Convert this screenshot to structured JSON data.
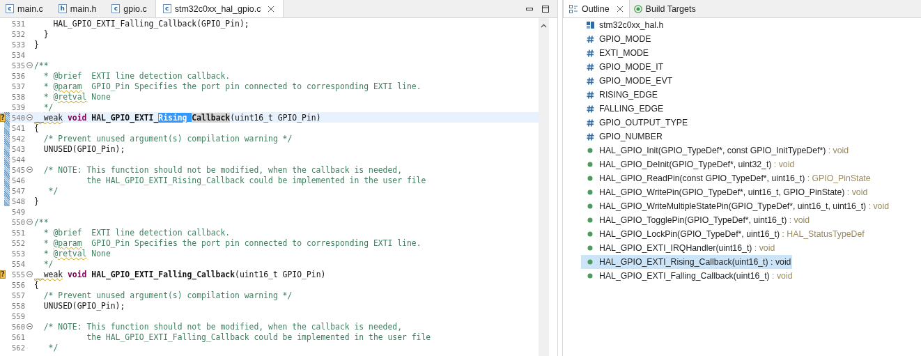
{
  "editor": {
    "tabs": [
      {
        "letter": "c",
        "label": "main.c",
        "selected": false
      },
      {
        "letter": "h",
        "label": "main.h",
        "selected": false
      },
      {
        "letter": "c",
        "label": "gpio.c",
        "selected": false
      },
      {
        "letter": "c",
        "label": "stm32c0xx_hal_gpio.c",
        "selected": true,
        "closable": true
      }
    ],
    "lines": [
      {
        "number": "531",
        "tokens": [
          {
            "text": "    HAL_GPIO_EXTI_Falling_Callback(GPIO_Pin);",
            "kind": "plain"
          }
        ]
      },
      {
        "number": "532",
        "tokens": [
          {
            "text": "  }",
            "kind": "plain"
          }
        ]
      },
      {
        "number": "533",
        "tokens": [
          {
            "text": "}",
            "kind": "plain"
          }
        ]
      },
      {
        "number": "534"
      },
      {
        "number": "535",
        "expanded": true,
        "tokens": [
          {
            "text": "/**",
            "kind": "comment"
          }
        ]
      },
      {
        "number": "536",
        "tokens": [
          {
            "text": "  * @brief  EXTI line detection callback.",
            "kind": "comment"
          }
        ]
      },
      {
        "number": "537",
        "tokens": [
          {
            "text": "  * ",
            "kind": "comment"
          },
          {
            "text": "@param",
            "kind": "comment",
            "misspelled": true
          },
          {
            "text": "  GPIO_Pin Specifies the port pin connected to corresponding EXTI line.",
            "kind": "comment"
          }
        ]
      },
      {
        "number": "538",
        "tokens": [
          {
            "text": "  * ",
            "kind": "comment"
          },
          {
            "text": "@retval",
            "kind": "comment",
            "misspelled": true
          },
          {
            "text": " None",
            "kind": "comment"
          }
        ]
      },
      {
        "number": "539",
        "tokens": [
          {
            "text": "  */",
            "kind": "comment"
          }
        ]
      },
      {
        "number": "540",
        "expanded": true,
        "annotation": "?",
        "current": true,
        "changed": true,
        "tokens": [
          {
            "text": "__weak",
            "kind": "plain",
            "misspelled": true
          },
          {
            "text": " void ",
            "kind": "keyword"
          },
          {
            "text": "HAL_GPIO_EXTI_",
            "kind": "function"
          },
          {
            "text": "Rising_",
            "kind": "selection"
          },
          {
            "text": "Callback",
            "kind": "occurrence"
          },
          {
            "text": "(uint16_t GPIO_Pin)",
            "kind": "plain"
          }
        ]
      },
      {
        "number": "541",
        "changed": true,
        "tokens": [
          {
            "text": "{",
            "kind": "plain"
          }
        ]
      },
      {
        "number": "542",
        "changed": true,
        "tokens": [
          {
            "text": "  /* Prevent unused argument(s) compilation warning */",
            "kind": "comment"
          }
        ]
      },
      {
        "number": "543",
        "changed": true,
        "tokens": [
          {
            "text": "  UNUSED(GPIO_Pin);",
            "kind": "plain"
          }
        ]
      },
      {
        "number": "544",
        "changed": true
      },
      {
        "number": "545",
        "expanded": true,
        "changed": true,
        "tokens": [
          {
            "text": "  /* NOTE: This function should not be modified, when the callback is needed,",
            "kind": "comment"
          }
        ]
      },
      {
        "number": "546",
        "changed": true,
        "tokens": [
          {
            "text": "           the HAL_GPIO_EXTI_Rising_Callback could be implemented in the user file",
            "kind": "comment"
          }
        ]
      },
      {
        "number": "547",
        "changed": true,
        "tokens": [
          {
            "text": "   */",
            "kind": "comment"
          }
        ]
      },
      {
        "number": "548",
        "changed": true,
        "tokens": [
          {
            "text": "}",
            "kind": "plain"
          }
        ]
      },
      {
        "number": "549"
      },
      {
        "number": "550",
        "expanded": true,
        "tokens": [
          {
            "text": "/**",
            "kind": "comment"
          }
        ]
      },
      {
        "number": "551",
        "tokens": [
          {
            "text": "  * @brief  EXTI line detection callback.",
            "kind": "comment"
          }
        ]
      },
      {
        "number": "552",
        "tokens": [
          {
            "text": "  * ",
            "kind": "comment"
          },
          {
            "text": "@param",
            "kind": "comment",
            "misspelled": true
          },
          {
            "text": "  GPIO_Pin Specifies the port pin connected to corresponding EXTI line.",
            "kind": "comment"
          }
        ]
      },
      {
        "number": "553",
        "tokens": [
          {
            "text": "  * ",
            "kind": "comment"
          },
          {
            "text": "@retval",
            "kind": "comment",
            "misspelled": true
          },
          {
            "text": " None",
            "kind": "comment"
          }
        ]
      },
      {
        "number": "554",
        "tokens": [
          {
            "text": "  */",
            "kind": "comment"
          }
        ]
      },
      {
        "number": "555",
        "expanded": true,
        "annotation": "?",
        "tokens": [
          {
            "text": "__weak",
            "kind": "plain",
            "misspelled": true
          },
          {
            "text": " void ",
            "kind": "keyword"
          },
          {
            "text": "HAL_GPIO_EXTI_Falling_Callback",
            "kind": "function"
          },
          {
            "text": "(uint16_t GPIO_Pin)",
            "kind": "plain"
          }
        ]
      },
      {
        "number": "556",
        "tokens": [
          {
            "text": "{",
            "kind": "plain"
          }
        ]
      },
      {
        "number": "557",
        "tokens": [
          {
            "text": "  /* Prevent unused argument(s) compilation warning */",
            "kind": "comment"
          }
        ]
      },
      {
        "number": "558",
        "tokens": [
          {
            "text": "  UNUSED(GPIO_Pin);",
            "kind": "plain"
          }
        ]
      },
      {
        "number": "559"
      },
      {
        "number": "560",
        "expanded": true,
        "tokens": [
          {
            "text": "  /* NOTE: This function should not be modified, when the callback is needed,",
            "kind": "comment"
          }
        ]
      },
      {
        "number": "561",
        "tokens": [
          {
            "text": "           the HAL_GPIO_EXTI_Falling_Callback could be implemented in the user file",
            "kind": "comment"
          }
        ]
      },
      {
        "number": "562",
        "tokens": [
          {
            "text": "   */",
            "kind": "comment"
          }
        ]
      }
    ]
  },
  "side_panel": {
    "tabs": [
      {
        "label": "Outline",
        "selected": true,
        "closable": true
      },
      {
        "label": "Build Targets",
        "selected": false
      }
    ],
    "outline_items": [
      {
        "kind": "include",
        "label": "stm32c0xx_hal.h",
        "selected": false
      },
      {
        "kind": "macro",
        "label": "GPIO_MODE",
        "selected": false
      },
      {
        "kind": "macro",
        "label": "EXTI_MODE",
        "selected": false
      },
      {
        "kind": "macro",
        "label": "GPIO_MODE_IT",
        "selected": false
      },
      {
        "kind": "macro",
        "label": "GPIO_MODE_EVT",
        "selected": false
      },
      {
        "kind": "macro",
        "label": "RISING_EDGE",
        "selected": false
      },
      {
        "kind": "macro",
        "label": "FALLING_EDGE",
        "selected": false
      },
      {
        "kind": "macro",
        "label": "GPIO_OUTPUT_TYPE",
        "selected": false
      },
      {
        "kind": "macro",
        "label": "GPIO_NUMBER",
        "selected": false
      },
      {
        "kind": "function",
        "label": "HAL_GPIO_Init(GPIO_TypeDef*, const GPIO_InitTypeDef*)",
        "type": " : void",
        "selected": false
      },
      {
        "kind": "function",
        "label": "HAL_GPIO_DeInit(GPIO_TypeDef*, uint32_t)",
        "type": " : void",
        "selected": false
      },
      {
        "kind": "function",
        "label": "HAL_GPIO_ReadPin(const GPIO_TypeDef*, uint16_t)",
        "type": " : GPIO_PinState",
        "selected": false
      },
      {
        "kind": "function",
        "label": "HAL_GPIO_WritePin(GPIO_TypeDef*, uint16_t, GPIO_PinState)",
        "type": " : void",
        "selected": false
      },
      {
        "kind": "function",
        "label": "HAL_GPIO_WriteMultipleStatePin(GPIO_TypeDef*, uint16_t, uint16_t)",
        "type": " : void",
        "selected": false
      },
      {
        "kind": "function",
        "label": "HAL_GPIO_TogglePin(GPIO_TypeDef*, uint16_t)",
        "type": " : void",
        "selected": false
      },
      {
        "kind": "function",
        "label": "HAL_GPIO_LockPin(GPIO_TypeDef*, uint16_t)",
        "type": " : HAL_StatusTypeDef",
        "selected": false
      },
      {
        "kind": "function",
        "label": "HAL_GPIO_EXTI_IRQHandler(uint16_t)",
        "type": " : void",
        "selected": false
      },
      {
        "kind": "function",
        "label": "HAL_GPIO_EXTI_Rising_Callback(uint16_t)",
        "type": " : void",
        "selected": true
      },
      {
        "kind": "function",
        "label": "HAL_GPIO_EXTI_Falling_Callback(uint16_t)",
        "type": " : void",
        "selected": false
      }
    ]
  }
}
